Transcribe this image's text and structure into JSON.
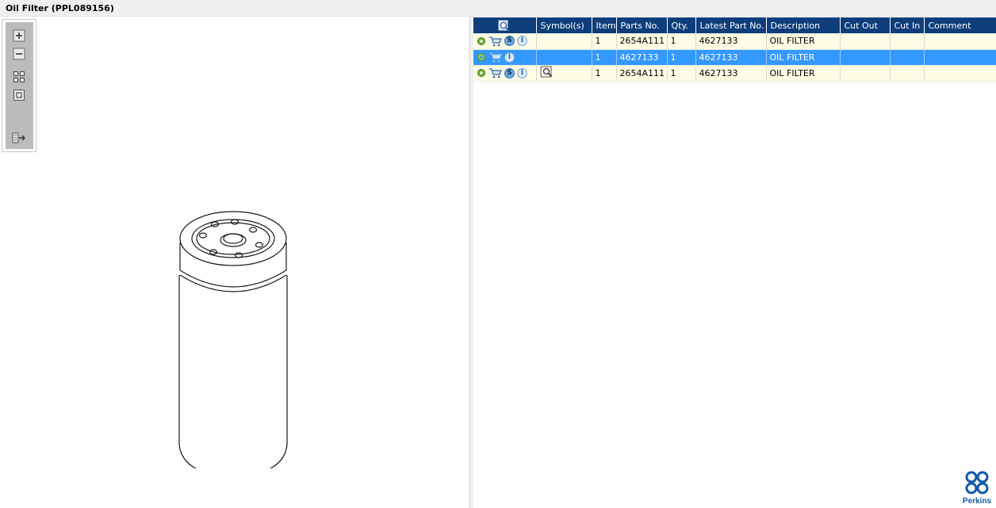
{
  "window": {
    "title": "Oil Filter (PPL089156)"
  },
  "toolbar": {
    "icons": [
      "zoom-in-icon",
      "zoom-out-icon",
      "fit-grid-icon",
      "actual-size-icon",
      "export-icon"
    ]
  },
  "table": {
    "columns": [
      "Symbol(s)",
      "Item",
      "Parts No.",
      "Qty.",
      "Latest Part No.",
      "Description",
      "Cut Out",
      "Cut In",
      "Comment"
    ],
    "rows": [
      {
        "item": "1",
        "parts_no": "2654A111",
        "qty": "1",
        "latest_part_no": "4627133",
        "description": "OIL FILTER",
        "cut_out": "",
        "cut_in": "",
        "comment": "",
        "has_service_icon": true,
        "has_symbol": false
      },
      {
        "item": "1",
        "parts_no": "4627133",
        "qty": "1",
        "latest_part_no": "4627133",
        "description": "OIL FILTER",
        "cut_out": "",
        "cut_in": "",
        "comment": "",
        "has_service_icon": false,
        "has_symbol": false
      },
      {
        "item": "1",
        "parts_no": "2654A111",
        "qty": "1",
        "latest_part_no": "4627133",
        "description": "OIL FILTER",
        "cut_out": "",
        "cut_in": "",
        "comment": "",
        "has_service_icon": true,
        "has_symbol": true
      }
    ]
  },
  "colors": {
    "header_bg": "#0d3d7a",
    "row_bg": "#fffde6",
    "selected_bg": "#3399ff",
    "logo": "#0f5aa8"
  },
  "logo": {
    "text": "Perkins"
  },
  "badges": {
    "s": "S",
    "i": "i"
  }
}
